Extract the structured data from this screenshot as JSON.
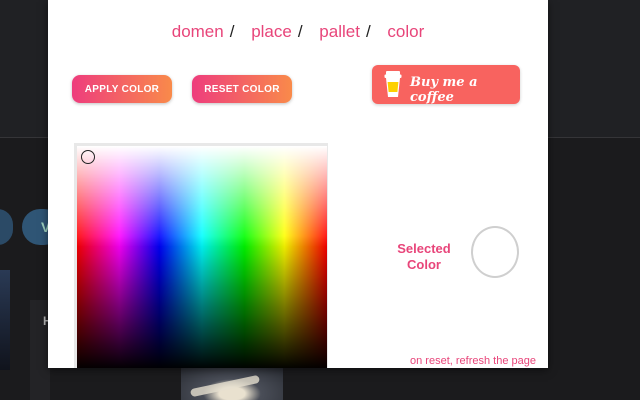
{
  "background": {
    "chip_letter": "V",
    "card_letter": "H"
  },
  "breadcrumb": {
    "items": [
      "domen",
      "place",
      "pallet",
      "color"
    ],
    "separator": "/"
  },
  "toolbar": {
    "apply_label": "APPLY COLOR",
    "reset_label": "RESET COLOR"
  },
  "coffee": {
    "label": "Buy me a coffee",
    "icon": "coffee-cup-icon",
    "color": "#f8635f"
  },
  "selected": {
    "label_line1": "Selected",
    "label_line2": "Color",
    "value": "#ffffff"
  },
  "note": "on reset, refresh the page",
  "colors": {
    "accent": "#e8457a",
    "button_gradient_start": "#ee3d7d",
    "button_gradient_end": "#f98a4a"
  }
}
